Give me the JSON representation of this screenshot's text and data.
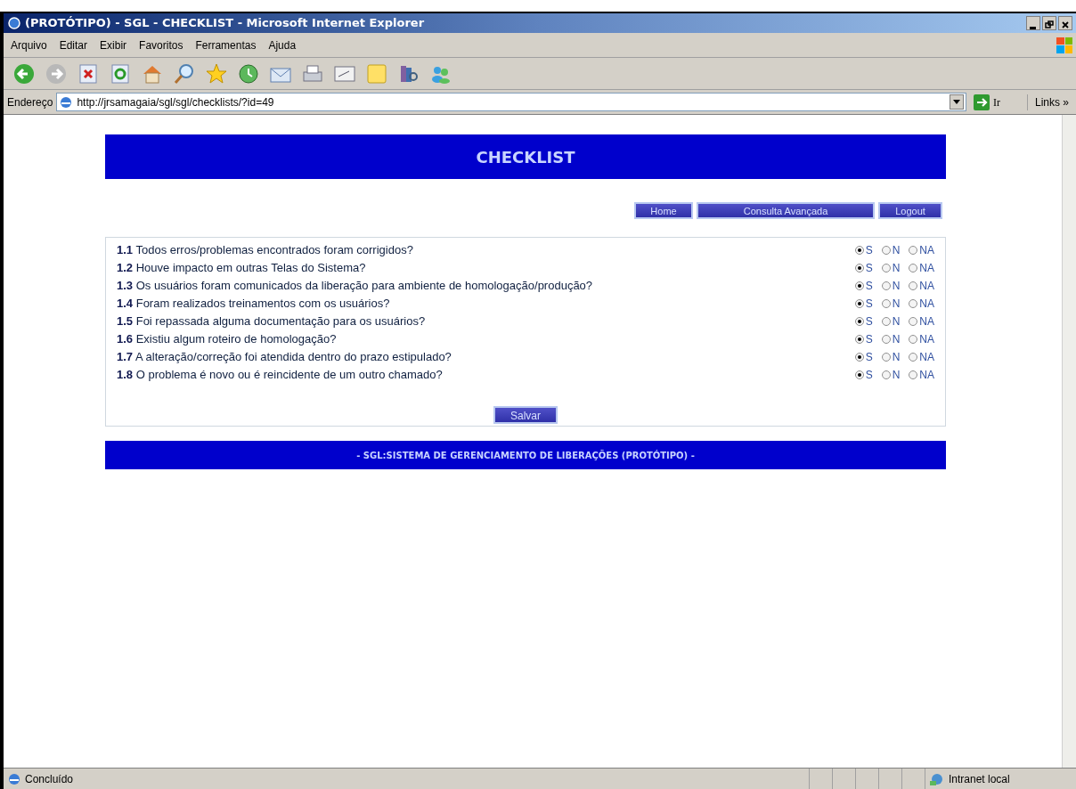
{
  "window": {
    "title": "(PROTÓTIPO) - SGL - CHECKLIST - Microsoft Internet Explorer"
  },
  "menu": [
    "Arquivo",
    "Editar",
    "Exibir",
    "Favoritos",
    "Ferramentas",
    "Ajuda"
  ],
  "address_bar": {
    "label": "Endereço",
    "url": "http://jrsamagaia/sgl/sgl/checklists/?id=49",
    "go": "Ir",
    "links": "Links",
    "links_chevron": "»"
  },
  "page": {
    "header": "CHECKLIST",
    "nav": [
      "Home",
      "Consulta Avançada",
      "Logout"
    ],
    "questions": [
      {
        "number": "1.1",
        "text": "Todos erros/problemas encontrados foram corrigidos?",
        "options": [
          {
            "label": "S",
            "selected": true
          },
          {
            "label": "N",
            "selected": false
          },
          {
            "label": "NA",
            "selected": false
          }
        ]
      },
      {
        "number": "1.2",
        "text": "Houve impacto em outras Telas do Sistema?",
        "options": [
          {
            "label": "S",
            "selected": true
          },
          {
            "label": "N",
            "selected": false
          },
          {
            "label": "NA",
            "selected": false
          }
        ]
      },
      {
        "number": "1.3",
        "text": "Os usuários foram comunicados da liberação para ambiente de homologação/produção?",
        "options": [
          {
            "label": "S",
            "selected": true
          },
          {
            "label": "N",
            "selected": false
          },
          {
            "label": "NA",
            "selected": false
          }
        ]
      },
      {
        "number": "1.4",
        "text": "Foram realizados treinamentos com os usuários?",
        "options": [
          {
            "label": "S",
            "selected": true
          },
          {
            "label": "N",
            "selected": false
          },
          {
            "label": "NA",
            "selected": false
          }
        ]
      },
      {
        "number": "1.5",
        "text": "Foi repassada alguma documentação para os usuários?",
        "options": [
          {
            "label": "S",
            "selected": true
          },
          {
            "label": "N",
            "selected": false
          },
          {
            "label": "NA",
            "selected": false
          }
        ]
      },
      {
        "number": "1.6",
        "text": "Existiu algum roteiro de homologação?",
        "options": [
          {
            "label": "S",
            "selected": true
          },
          {
            "label": "N",
            "selected": false
          },
          {
            "label": "NA",
            "selected": false
          }
        ]
      },
      {
        "number": "1.7",
        "text": "A alteração/correção foi atendida dentro do prazo estipulado?",
        "options": [
          {
            "label": "S",
            "selected": true
          },
          {
            "label": "N",
            "selected": false
          },
          {
            "label": "NA",
            "selected": false
          }
        ]
      },
      {
        "number": "1.8",
        "text": "O problema é novo ou é reincidente de um outro chamado?",
        "options": [
          {
            "label": "S",
            "selected": true
          },
          {
            "label": "N",
            "selected": false
          },
          {
            "label": "NA",
            "selected": false
          }
        ]
      }
    ],
    "save_button": "Salvar",
    "footer": "- SGL:SISTEMA DE GERENCIAMENTO DE LIBERAÇÕES (PROTÓTIPO) -"
  },
  "status_bar": {
    "status": "Concluído",
    "zone": "Intranet local"
  }
}
